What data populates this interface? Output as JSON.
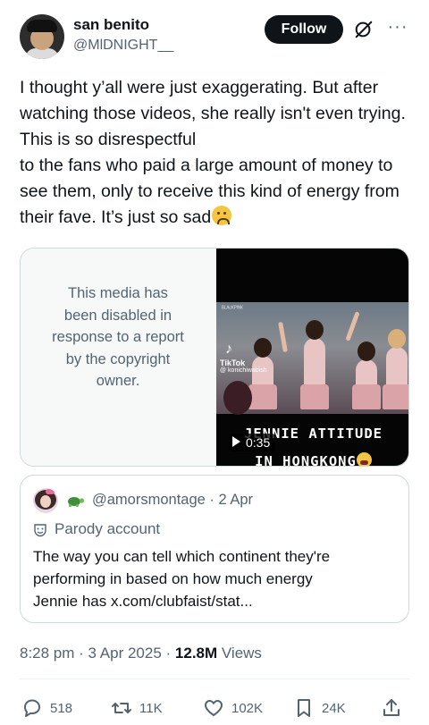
{
  "author": {
    "name": "san benito",
    "handle": "@MlDNIGHT__",
    "follow_label": "Follow"
  },
  "tweet": {
    "text": "I thought y’all were just exaggerating. But after watching those videos, she really isn't even trying. This is so disrespectful\nto the fans who paid a large amount of money to see them, only to receive this kind of energy from their fave. It’s just so sad"
  },
  "media": {
    "disabled_message": "This media has been disabled in response to a report by the copyright owner.",
    "video_duration": "0:35",
    "caption_line1": "JENNIE ATTITUDE",
    "caption_line2": "IN HONGKONG",
    "tiktok_label": "TikTok",
    "tiktok_user": "@ konichiwabish"
  },
  "quote": {
    "handle": "@amorsmontage",
    "date": "2 Apr",
    "account_label": "Parody account",
    "text": "The way you can tell which continent they're performing in based on how much energy\nJennie has x.com/clubfaist/stat..."
  },
  "meta": {
    "time": "8:28 pm",
    "date": "3 Apr 2025",
    "views_count": "12.8M",
    "views_label": "Views"
  },
  "actions": {
    "replies": "518",
    "reposts": "11K",
    "likes": "102K",
    "bookmarks": "24K"
  },
  "colors": {
    "text": "#0f1419",
    "secondary": "#536471",
    "border": "#cfd9de",
    "follow_bg": "#0f1419"
  }
}
